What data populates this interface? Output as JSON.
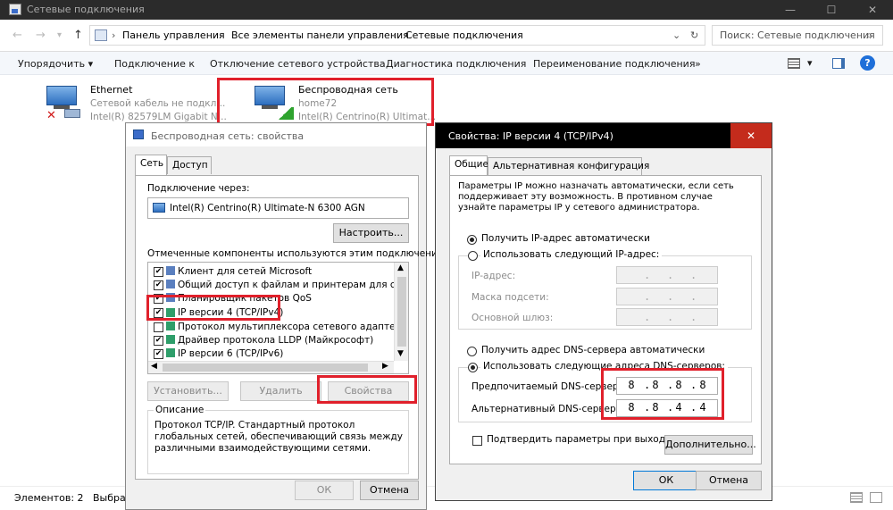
{
  "window": {
    "title": "Сетевые подключения",
    "controls": [
      "—",
      "☐",
      "✕"
    ]
  },
  "address": {
    "crumbs": [
      "Панель управления",
      "Все элементы панели управления",
      "Сетевые подключения"
    ],
    "search_placeholder": "Поиск: Сетевые подключения"
  },
  "commandbar": {
    "items": [
      "Упорядочить ▾",
      "Подключение к",
      "Отключение сетевого устройства",
      "Диагностика подключения",
      "Переименование подключения",
      "»"
    ]
  },
  "adapters": [
    {
      "name": "Ethernet",
      "status": "Сетевой кабель не подкл...",
      "device": "Intel(R) 82579LM Gigabit N..."
    },
    {
      "name": "Беспроводная сеть",
      "status": "home72",
      "device": "Intel(R) Centrino(R) Ultimat..."
    }
  ],
  "statusbar": {
    "items": "Элементов: 2",
    "selected": "Выбра"
  },
  "props": {
    "title": "Беспроводная сеть: свойства",
    "tabs": [
      "Сеть",
      "Доступ"
    ],
    "connect_label": "Подключение через:",
    "adapter": "Intel(R) Centrino(R) Ultimate-N 6300 AGN",
    "configure": "Настроить...",
    "components_label": "Отмеченные компоненты используются этим подключением:",
    "components": [
      "Клиент для сетей Microsoft",
      "Общий доступ к файлам и принтерам для сетей Mi",
      "Планировщик пакетов QoS",
      "IP версии 4 (TCP/IPv4)",
      "Протокол мультиплексора сетевого адаптера (Ма",
      "Драйвер протокола LLDP (Майкрософт)",
      "IP версии 6 (TCP/IPv6)"
    ],
    "install": "Установить...",
    "remove": "Удалить",
    "properties": "Свойства",
    "desc_label": "Описание",
    "desc_text": "Протокол TCP/IP. Стандартный протокол глобальных сетей, обеспечивающий связь между различными взаимодействующими сетями.",
    "ok": "ОК",
    "cancel": "Отмена"
  },
  "ipv4": {
    "title": "Свойства: IP версии 4 (TCP/IPv4)",
    "tabs": [
      "Общие",
      "Альтернативная конфигурация"
    ],
    "intro": "Параметры IP можно назначать автоматически, если сеть поддерживает эту возможность. В противном случае узнайте параметры IP у сетевого администратора.",
    "auto_ip": "Получить IP-адрес автоматически",
    "manual_ip": "Использовать следующий IP-адрес:",
    "ip_label": "IP-адрес:",
    "mask_label": "Маска подсети:",
    "gw_label": "Основной шлюз:",
    "auto_dns": "Получить адрес DNS-сервера автоматически",
    "manual_dns": "Использовать следующие адреса DNS-серверов:",
    "pref_dns_label": "Предпочитаемый DNS-сервер:",
    "alt_dns_label": "Альтернативный DNS-сервер:",
    "pref_dns": [
      "8",
      "8",
      "8",
      "8"
    ],
    "alt_dns": [
      "8",
      "8",
      "4",
      "4"
    ],
    "validate": "Подтвердить параметры при выходе",
    "advanced": "Дополнительно...",
    "ok": "ОК",
    "cancel": "Отмена",
    "close": "✕"
  },
  "colors": {
    "highlight": "#e0202b",
    "accent": "#0078d7"
  }
}
